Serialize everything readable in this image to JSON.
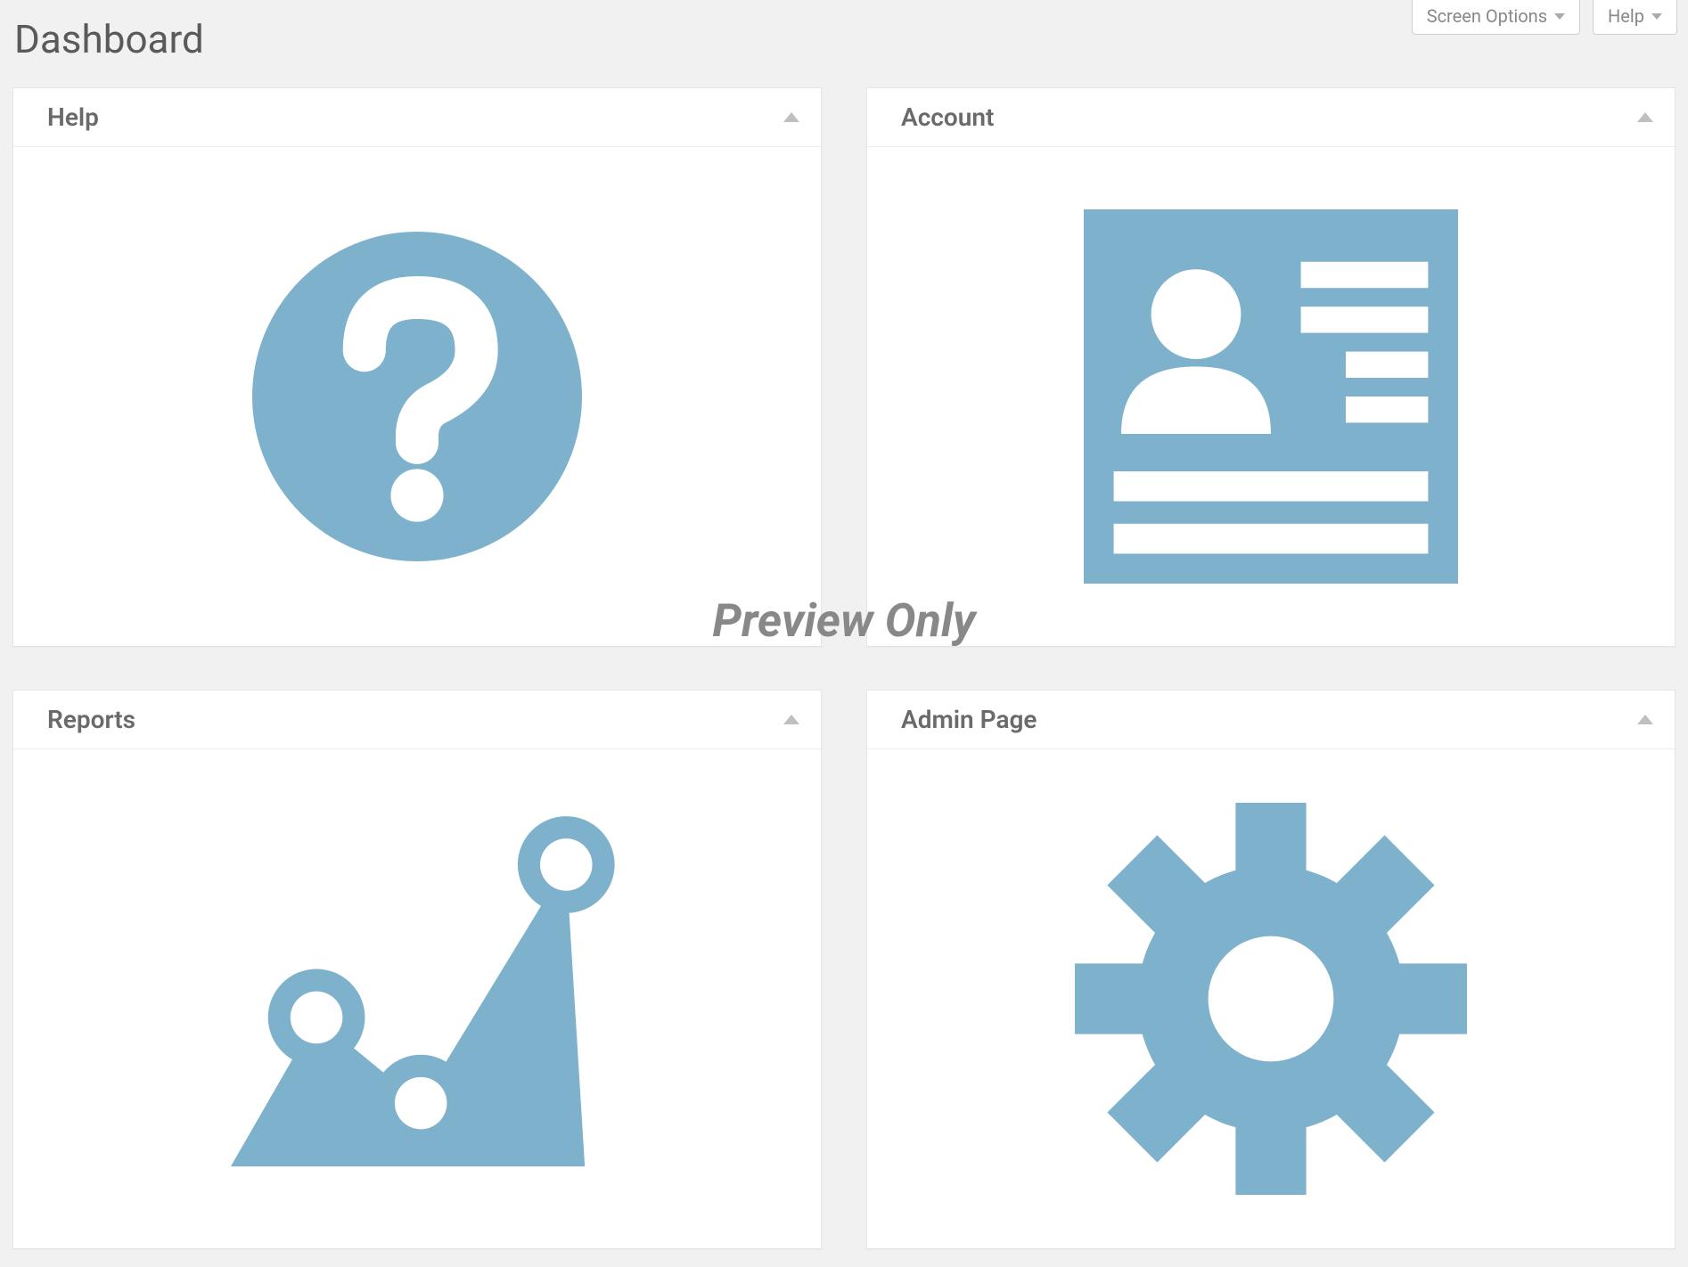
{
  "page": {
    "title": "Dashboard"
  },
  "topbar": {
    "screen_options_label": "Screen Options",
    "help_label": "Help"
  },
  "widgets": {
    "help": {
      "title": "Help",
      "icon": "question-circle-icon"
    },
    "account": {
      "title": "Account",
      "icon": "profile-card-icon"
    },
    "reports": {
      "title": "Reports",
      "icon": "line-chart-icon"
    },
    "admin": {
      "title": "Admin Page",
      "icon": "gear-icon"
    }
  },
  "overlay": {
    "watermark": "Preview Only"
  },
  "colors": {
    "icon_fill": "#7eb1cc"
  }
}
